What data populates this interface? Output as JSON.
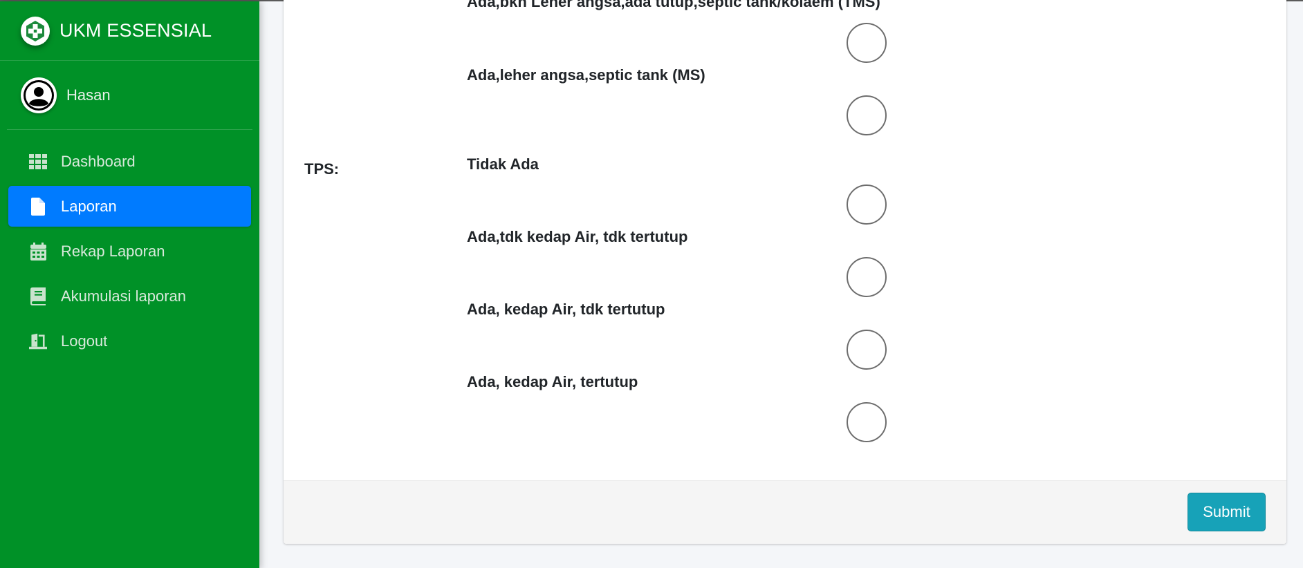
{
  "brand": {
    "title": "UKM ESSENSIAL"
  },
  "user": {
    "name": "Hasan"
  },
  "sidebar": {
    "items": [
      {
        "label": "Dashboard",
        "icon": "grid-icon"
      },
      {
        "label": "Laporan",
        "icon": "file-icon",
        "active": true
      },
      {
        "label": "Rekap Laporan",
        "icon": "calendar-icon"
      },
      {
        "label": "Akumulasi laporan",
        "icon": "book-icon"
      },
      {
        "label": "Logout",
        "icon": "door-icon"
      }
    ]
  },
  "form": {
    "partial_option_label": "Ada,bkn Leher angsa,ada tutup,septic tank/kolaem (TMS)",
    "previous_option_label": "Ada,leher angsa,septic tank (MS)",
    "field_label": "TPS:",
    "options": [
      "Tidak Ada",
      "Ada,tdk kedap Air, tdk tertutup",
      "Ada, kedap Air, tdk tertutup",
      "Ada, kedap Air, tertutup"
    ],
    "submit_label": "Submit"
  },
  "colors": {
    "sidebar_bg": "#009127",
    "active_item": "#007bff",
    "submit_button": "#17a2b8"
  }
}
